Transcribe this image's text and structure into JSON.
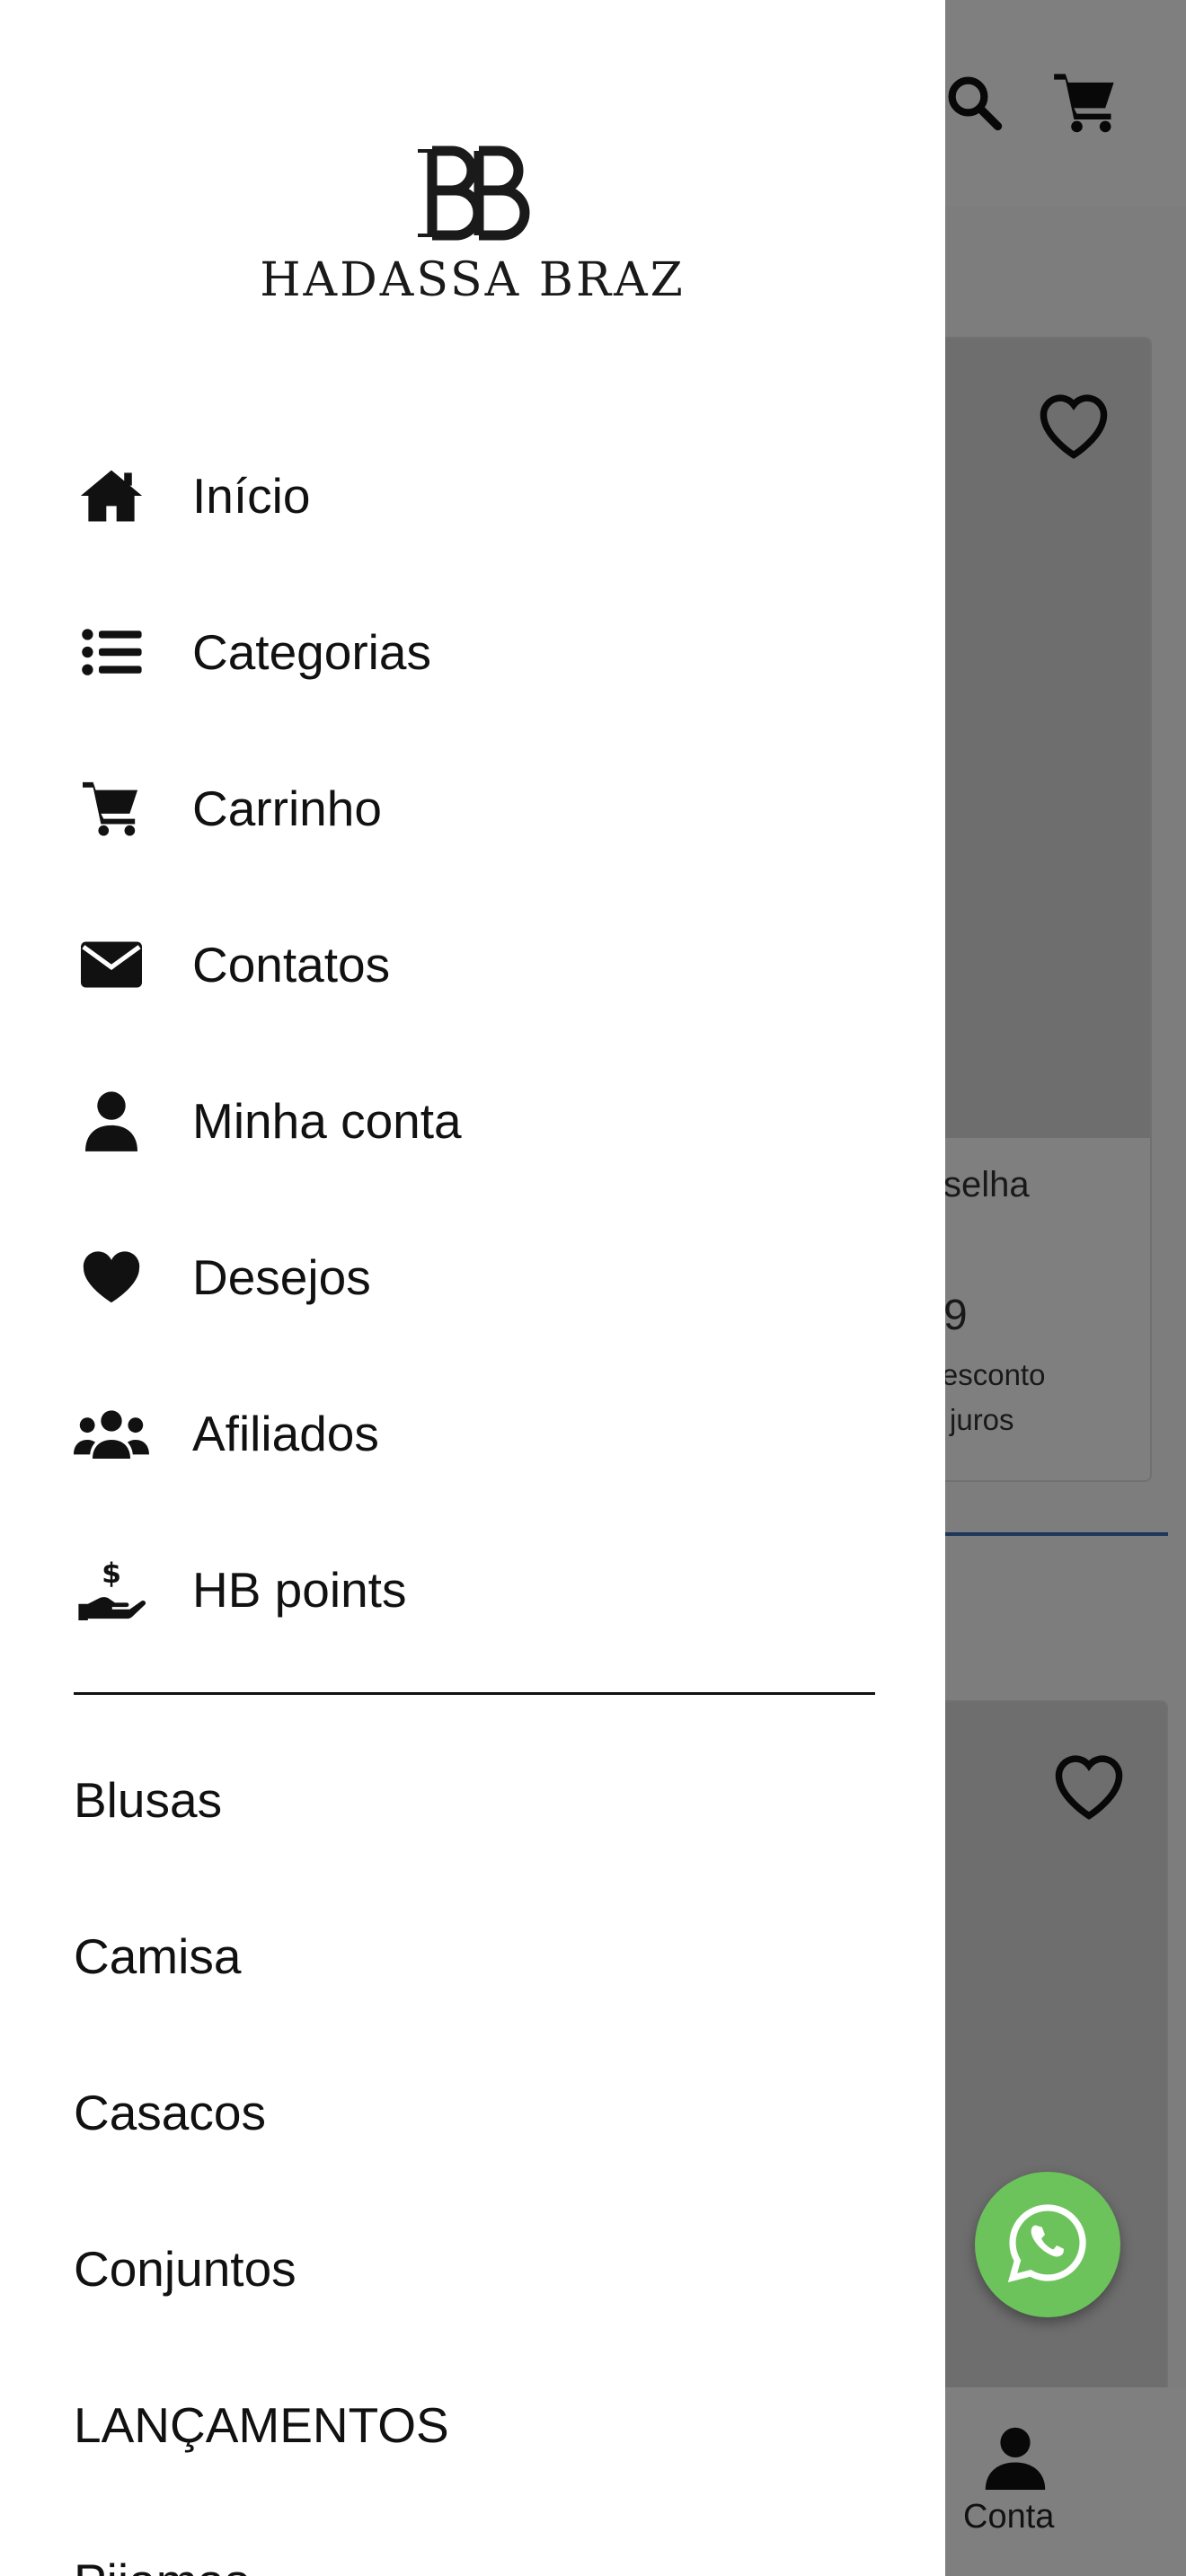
{
  "background": {
    "product_card_1": {
      "title_fragment": "selha",
      "price_fragment": "9",
      "note_line1": "n desconto",
      "note_line2": "em juros"
    },
    "bottom_nav": {
      "account_label": "Conta"
    }
  },
  "drawer": {
    "brand": {
      "monogram": "BB",
      "name": "HADASSA BRAZ"
    },
    "menu": [
      {
        "label": "Início",
        "icon": "home-icon"
      },
      {
        "label": "Categorias",
        "icon": "list-icon"
      },
      {
        "label": "Carrinho",
        "icon": "cart-icon"
      },
      {
        "label": "Contatos",
        "icon": "envelope-icon"
      },
      {
        "label": "Minha conta",
        "icon": "user-icon"
      },
      {
        "label": "Desejos",
        "icon": "heart-icon"
      },
      {
        "label": "Afiliados",
        "icon": "users-icon"
      },
      {
        "label": "HB points",
        "icon": "hand-coin-icon"
      }
    ],
    "categories": [
      "Blusas",
      "Camisa",
      "Casacos",
      "Conjuntos",
      "LANÇAMENTOS",
      "Pijamas"
    ]
  },
  "colors": {
    "scrim": "#000000",
    "whatsapp": "#6cc35b",
    "accent_line": "#3b6db3"
  }
}
